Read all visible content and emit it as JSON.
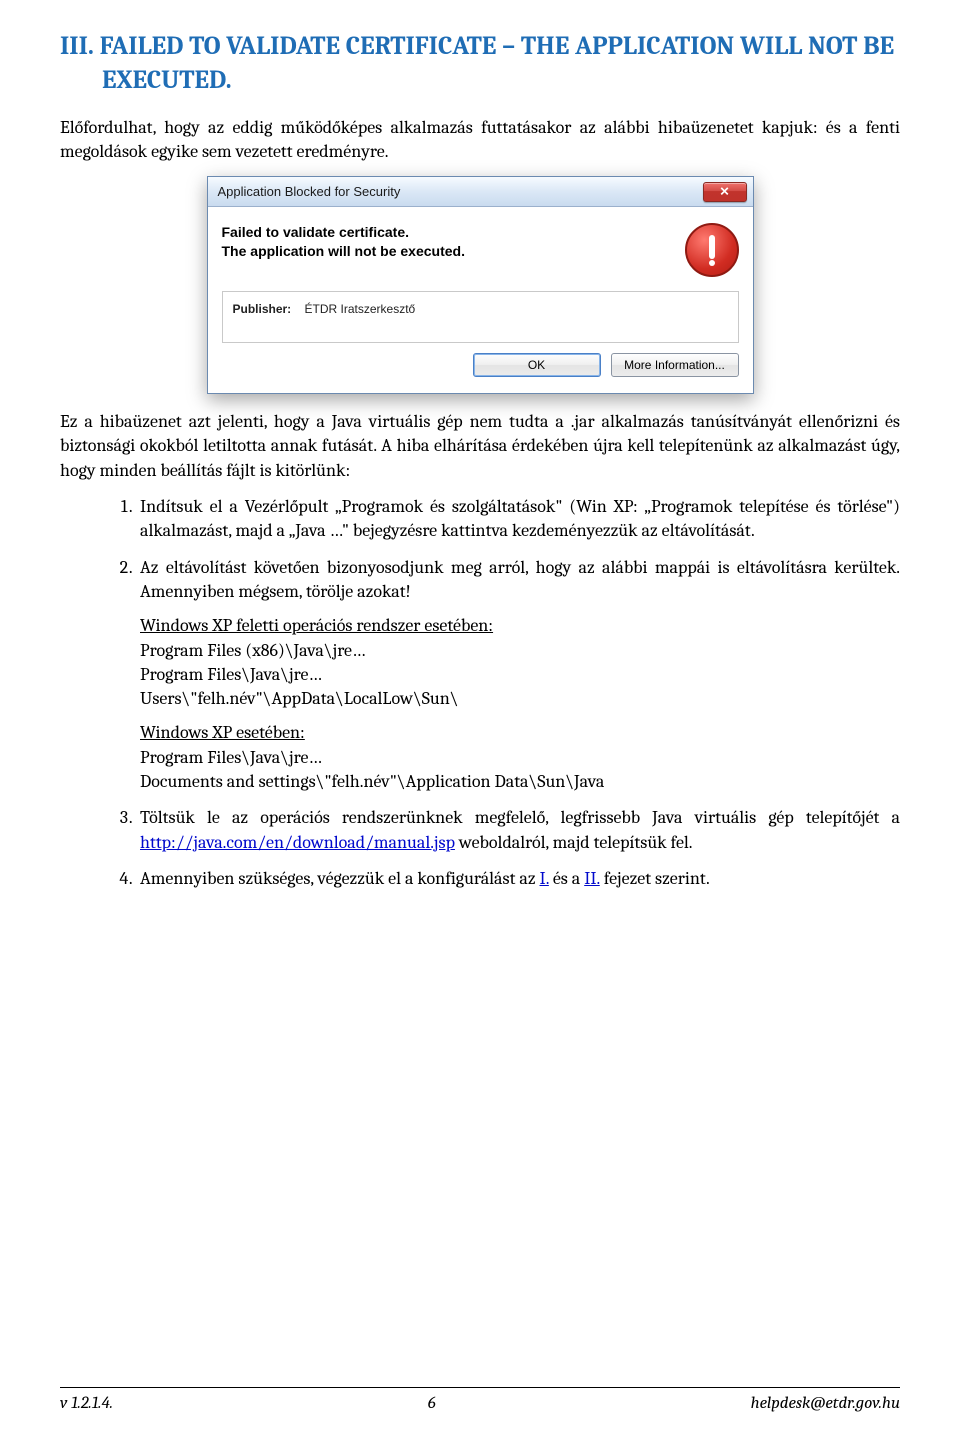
{
  "heading": "III.  FAILED TO VALIDATE CERTIFICATE – THE APPLICATION WILL NOT BE EXECUTED.",
  "intro": "Előfordulhat, hogy az eddig működőképes alkalmazás futtatásakor az alábbi hibaüzenetet kapjuk: és a fenti megoldások egyike sem vezetett eredményre.",
  "dialog": {
    "title": "Application Blocked for Security",
    "line1": "Failed to validate certificate.",
    "line2": "The application will not be executed.",
    "publisher_label": "Publisher:",
    "publisher_value": "ÉTDR Iratszerkesztő",
    "ok": "OK",
    "more": "More Information..."
  },
  "after_image": "Ez a hibaüzenet azt jelenti, hogy a Java virtuális gép nem tudta a .jar alkalmazás tanúsítványát ellenőrizni és biztonsági okokból letiltotta annak futását. A hiba elhárítása érdekében újra kell telepítenünk az alkalmazást úgy, hogy minden beállítás fájlt is kitörlünk:",
  "items": {
    "i1": "Indítsuk el a Vezérlőpult „Programok és szolgáltatások\" (Win XP: „Programok telepítése és törlése\") alkalmazást, majd a „Java …\" bejegyzésre kattintva kezdeményezzük az eltávolítását.",
    "i2": "Az eltávolítást követően bizonyosodjunk meg arról, hogy az alábbi mappái is eltávolításra kerültek. Amennyiben mégsem, törölje azokat!",
    "i2_block1_title": "Windows XP feletti operációs rendszer esetében:",
    "i2_block1_l1": "Program Files (x86)\\Java\\jre…",
    "i2_block1_l2": "Program Files\\Java\\jre…",
    "i2_block1_l3": "Users\\\"felh.név\"\\AppData\\LocalLow\\Sun\\",
    "i2_block2_title": "Windows XP esetében:",
    "i2_block2_l1": "Program Files\\Java\\jre…",
    "i2_block2_l2": "Documents and settings\\\"felh.név\"\\Application Data\\Sun\\Java",
    "i3_a": "Töltsük le az operációs rendszerünknek megfelelő, legfrissebb Java virtuális gép telepítőjét a ",
    "i3_link": "http://java.com/en/download/manual.jsp",
    "i3_b": " weboldalról, majd telepítsük fel.",
    "i4_a": "Amennyiben szükséges, végezzük el a konfigurálást az ",
    "i4_l1": "I.",
    "i4_mid": " és a ",
    "i4_l2": "II.",
    "i4_b": " fejezet szerint."
  },
  "footer": {
    "left": "v 1.2.1.4.",
    "center": "6",
    "right": "helpdesk@etdr.gov.hu"
  }
}
